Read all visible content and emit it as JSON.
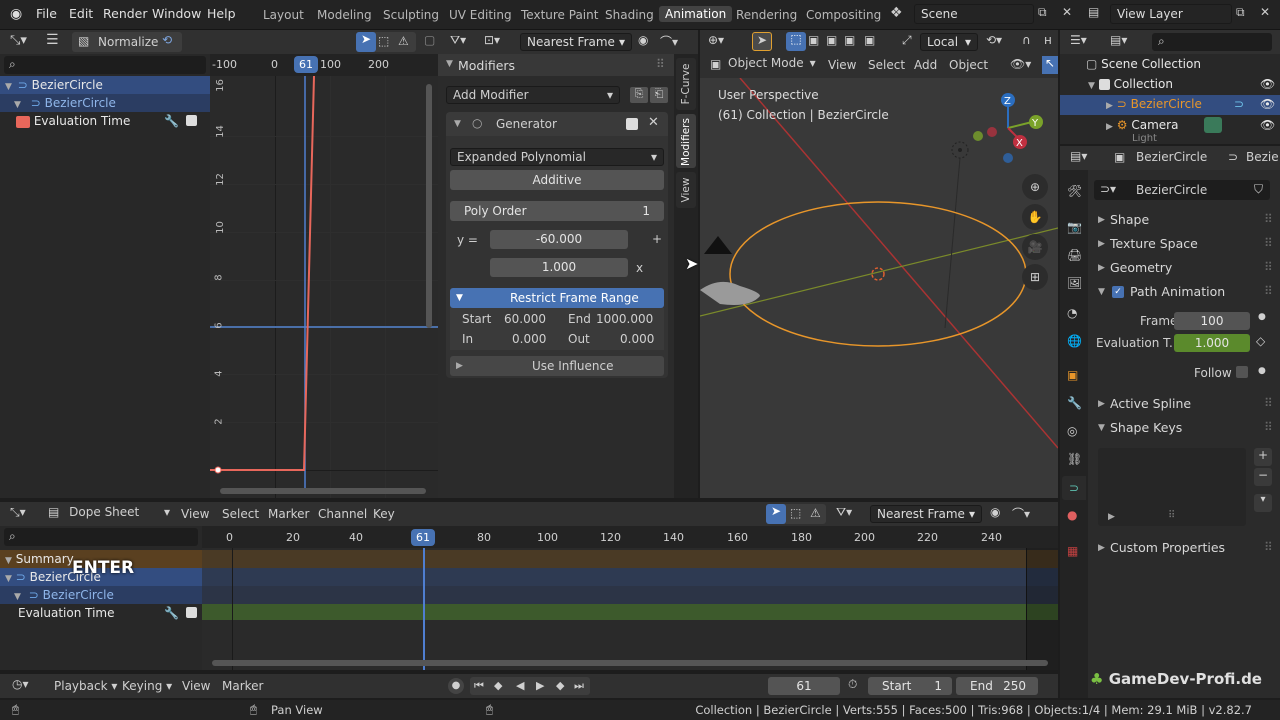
{
  "menu": {
    "items": [
      "File",
      "Edit",
      "Render",
      "Window",
      "Help"
    ]
  },
  "workspaces": [
    "Layout",
    "Modeling",
    "Sculpting",
    "UV Editing",
    "Texture Paint",
    "Shading",
    "Animation",
    "Rendering",
    "Compositing"
  ],
  "scene": {
    "name": "Scene"
  },
  "view_layer": {
    "name": "View Layer"
  },
  "graph": {
    "normalize_label": "Normalize",
    "snap_label": "Nearest Frame",
    "frame_ticks": [
      "-100",
      "0",
      "61",
      "100",
      "200"
    ],
    "value_ticks": [
      "16",
      "14",
      "12",
      "10",
      "8",
      "6",
      "4",
      "2"
    ],
    "channels": [
      "BezierCircle",
      "BezierCircle",
      "Evaluation Time"
    ]
  },
  "modifiers": {
    "title": "Modifiers",
    "add_label": "Add Modifier",
    "generator_label": "Generator",
    "mode_value": "Expanded Polynomial",
    "additive_label": "Additive",
    "poly_order_label": "Poly Order",
    "poly_order_value": "1",
    "y_label": "y =",
    "coef0": "-60.000",
    "coef1": "1.000",
    "plus": "+",
    "x_label": "x",
    "restrict_label": "Restrict Frame Range",
    "start_label": "Start",
    "start_value": "60.000",
    "end_label": "End",
    "end_value": "1000.000",
    "in_label": "In",
    "in_value": "0.000",
    "out_label": "Out",
    "out_value": "0.000",
    "influence_label": "Use Influence",
    "tabs": [
      "F-Curve",
      "Modifiers",
      "View"
    ]
  },
  "viewport": {
    "mode_label": "Object Mode",
    "menus": [
      "View",
      "Select",
      "Add",
      "Object"
    ],
    "orientation": "Local",
    "persp_label": "User Perspective",
    "collection_label": "(61) Collection | BezierCircle"
  },
  "outliner": {
    "items": [
      "Scene Collection",
      "Collection",
      "BezierCircle",
      "Camera",
      "Light"
    ]
  },
  "properties": {
    "object_name": "BezierCircle",
    "data_name": "BezierCircle",
    "data_name_short": "Bezie",
    "sections": [
      "Shape",
      "Texture Space",
      "Geometry",
      "Path Animation"
    ],
    "frames_label": "Frames",
    "frames_value": "100",
    "eval_label": "Evaluation T..",
    "eval_value": "1.000",
    "follow_label": "Follow",
    "sections2": [
      "Active Spline",
      "Shape Keys",
      "Custom Properties"
    ]
  },
  "dopesheet": {
    "mode_label": "Dope Sheet",
    "menus": [
      "View",
      "Select",
      "Marker",
      "Channel",
      "Key"
    ],
    "snap_label": "Nearest Frame",
    "ticks": [
      "0",
      "20",
      "40",
      "61",
      "80",
      "100",
      "120",
      "140",
      "160",
      "180",
      "200",
      "220",
      "240"
    ],
    "channels": [
      "Summary",
      "BezierCircle",
      "BezierCircle",
      "Evaluation Time"
    ],
    "overlay_text": "ENTER"
  },
  "timeline": {
    "menus": [
      "Playback",
      "Keying",
      "View",
      "Marker"
    ],
    "current_frame": "61",
    "start_label": "Start",
    "start_value": "1",
    "end_label": "End",
    "end_value": "250"
  },
  "status": {
    "pan_label": "Pan View",
    "info": "Collection | BezierCircle | Verts:555 | Faces:500 | Tris:968 | Objects:1/4 | Mem: 29.1 MiB | v2.82.7",
    "watermark": "GameDev-Profi.de"
  },
  "colors": {
    "accent": "#4772b3",
    "curve": "#e8675b",
    "active_green": "#5b8a2c",
    "selection": "#334d80"
  }
}
